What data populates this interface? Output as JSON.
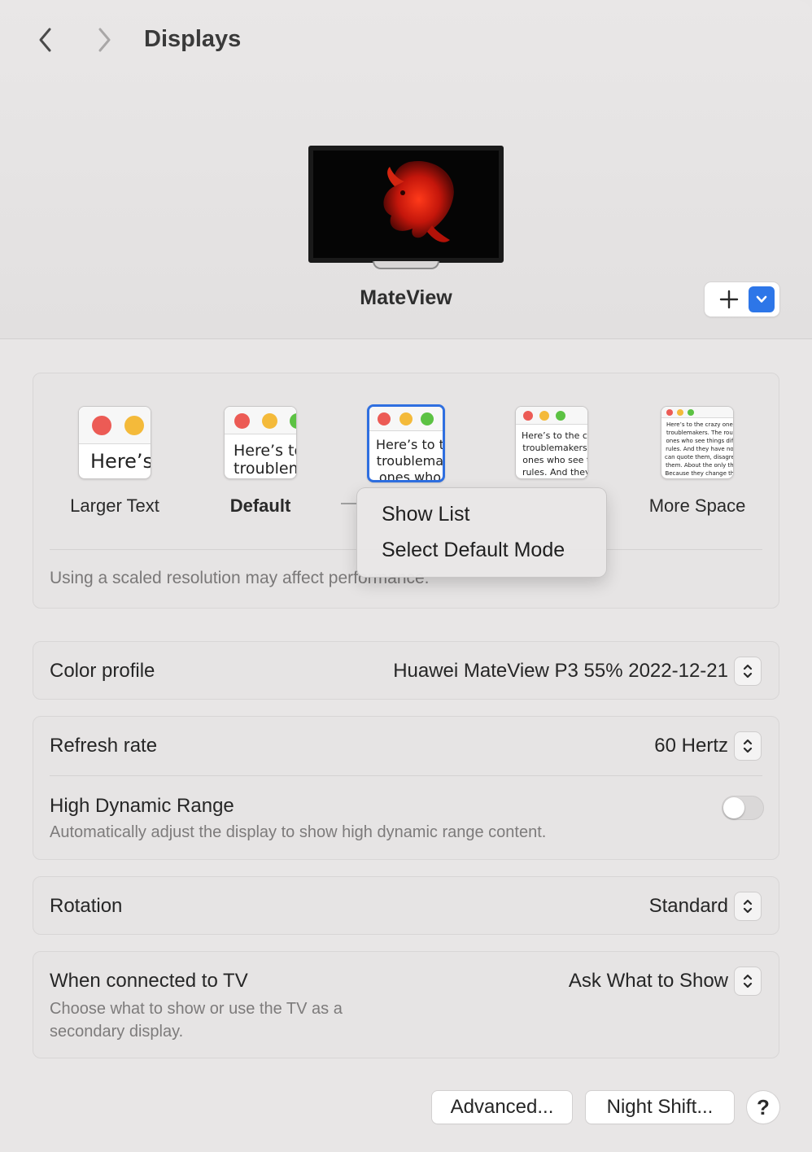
{
  "header": {
    "title": "Displays",
    "back_icon": "chevron-left-icon",
    "forward_icon": "chevron-right-icon",
    "display_name": "MateView",
    "add_icon": "plus-icon",
    "add_menu_icon": "chevron-down-icon"
  },
  "resolution": {
    "options": [
      {
        "label": "Larger Text",
        "sample": "Here’s"
      },
      {
        "label": "Default",
        "sample": "Here’s to\ntroublem"
      },
      {
        "label": "",
        "sample": "Here’s to t\ntroublema\nones who"
      },
      {
        "label": "",
        "sample": "Here’s to the cr\ntroublemakers.\nones who see t\nrules. And they"
      },
      {
        "label": "More Space",
        "sample": "Here’s to the crazy one\ntroublemakers. The rou\nones who see things dif\nrules. And they have no\ncan quote them, disagre\nthem. About the only th\nBecause they change th"
      }
    ],
    "selected_index": 2,
    "note": "Using a scaled resolution may affect performance."
  },
  "context_menu": {
    "items": [
      "Show List",
      "Select Default Mode"
    ]
  },
  "color_profile": {
    "label": "Color profile",
    "value": "Huawei MateView P3 55% 2022-12-21"
  },
  "refresh_rate": {
    "label": "Refresh rate",
    "value": "60 Hertz"
  },
  "hdr": {
    "label": "High Dynamic Range",
    "description": "Automatically adjust the display to show high dynamic range content.",
    "enabled": false
  },
  "rotation": {
    "label": "Rotation",
    "value": "Standard"
  },
  "tv": {
    "label": "When connected to TV",
    "description_line1": "Choose what to show or use the TV as a",
    "description_line2": "secondary display.",
    "value": "Ask What to Show"
  },
  "buttons": {
    "advanced": "Advanced...",
    "night_shift": "Night Shift...",
    "help": "?"
  },
  "colors": {
    "accent": "#2d76e8",
    "background": "#e8e6e6"
  }
}
